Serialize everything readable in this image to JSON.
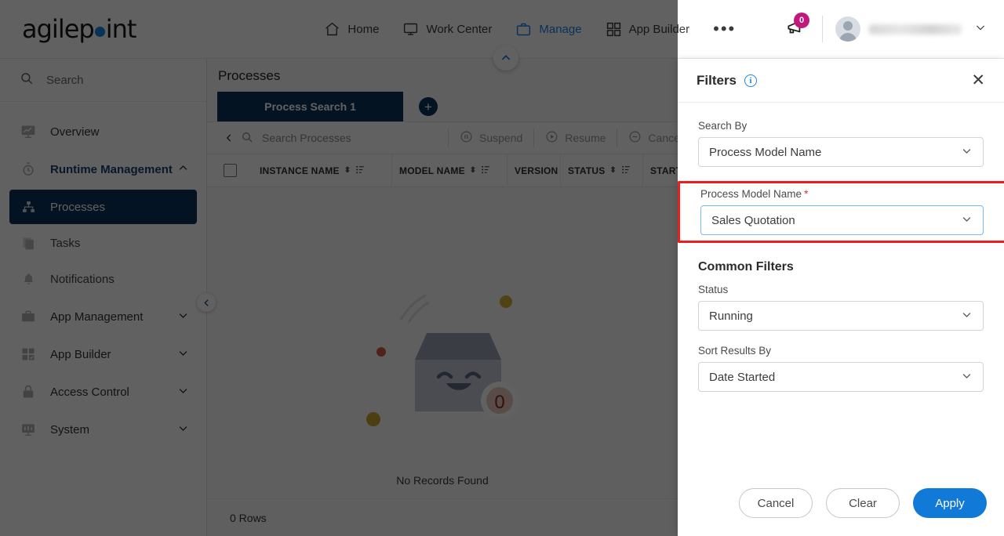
{
  "brand": {
    "name_part1": "agilep",
    "name_part2": "int"
  },
  "topnav": {
    "items": [
      {
        "label": "Home",
        "icon": "home-icon",
        "active": false
      },
      {
        "label": "Work Center",
        "icon": "monitor-icon",
        "active": false
      },
      {
        "label": "Manage",
        "icon": "briefcase-icon",
        "active": true
      },
      {
        "label": "App Builder",
        "icon": "grid-icon",
        "active": false
      }
    ],
    "more_label": "•••",
    "notification_count": "0",
    "user_name": ""
  },
  "sidebar": {
    "search_placeholder": "Search",
    "items": [
      {
        "label": "Overview",
        "icon": "chart-monitor-icon",
        "expandable": false,
        "state": ""
      },
      {
        "label": "Runtime Management",
        "icon": "stopwatch-icon",
        "expandable": true,
        "state": "open"
      },
      {
        "label": "App Management",
        "icon": "briefcase-icon",
        "expandable": true,
        "state": "collapsed"
      },
      {
        "label": "App Builder",
        "icon": "grid-check-icon",
        "expandable": true,
        "state": "collapsed"
      },
      {
        "label": "Access Control",
        "icon": "lock-icon",
        "expandable": true,
        "state": "collapsed"
      },
      {
        "label": "System",
        "icon": "system-monitor-icon",
        "expandable": true,
        "state": "collapsed"
      }
    ],
    "subitems": [
      {
        "label": "Processes",
        "icon": "hierarchy-icon",
        "selected": true
      },
      {
        "label": "Tasks",
        "icon": "tasks-icon",
        "selected": false
      },
      {
        "label": "Notifications",
        "icon": "bell-icon",
        "selected": false
      }
    ]
  },
  "main": {
    "page_title": "Processes",
    "tab_label": "Process Search 1",
    "add_tab_label": "+",
    "toolbar": {
      "search_placeholder": "Search Processes",
      "actions": [
        {
          "label": "Suspend",
          "icon": "pause-circle-icon"
        },
        {
          "label": "Resume",
          "icon": "play-circle-icon"
        },
        {
          "label": "Cancel",
          "icon": "minus-circle-icon"
        }
      ]
    },
    "columns": [
      "INSTANCE NAME",
      "MODEL NAME",
      "VERSION",
      "STATUS",
      "START"
    ],
    "empty_text": "No Records Found",
    "empty_badge": "0",
    "rows_text": "0 Rows"
  },
  "filters": {
    "title": "Filters",
    "info_icon": "info-icon",
    "close_icon": "close-icon",
    "search_by_label": "Search By",
    "search_by_value": "Process Model Name",
    "model_name_label": "Process Model Name",
    "model_name_required": "*",
    "model_name_value": "Sales Quotation",
    "common_filters_label": "Common Filters",
    "status_label": "Status",
    "status_value": "Running",
    "sort_label": "Sort Results By",
    "sort_value": "Date Started",
    "cancel_label": "Cancel",
    "clear_label": "Clear",
    "apply_label": "Apply"
  },
  "colors": {
    "brand_blue": "#1a85e8",
    "nav_active": "#1a85e8",
    "sidebar_selected": "#0b3259",
    "highlight_red": "#f01c1c",
    "apply_blue": "#1179d8",
    "badge_magenta": "#c2187c"
  }
}
